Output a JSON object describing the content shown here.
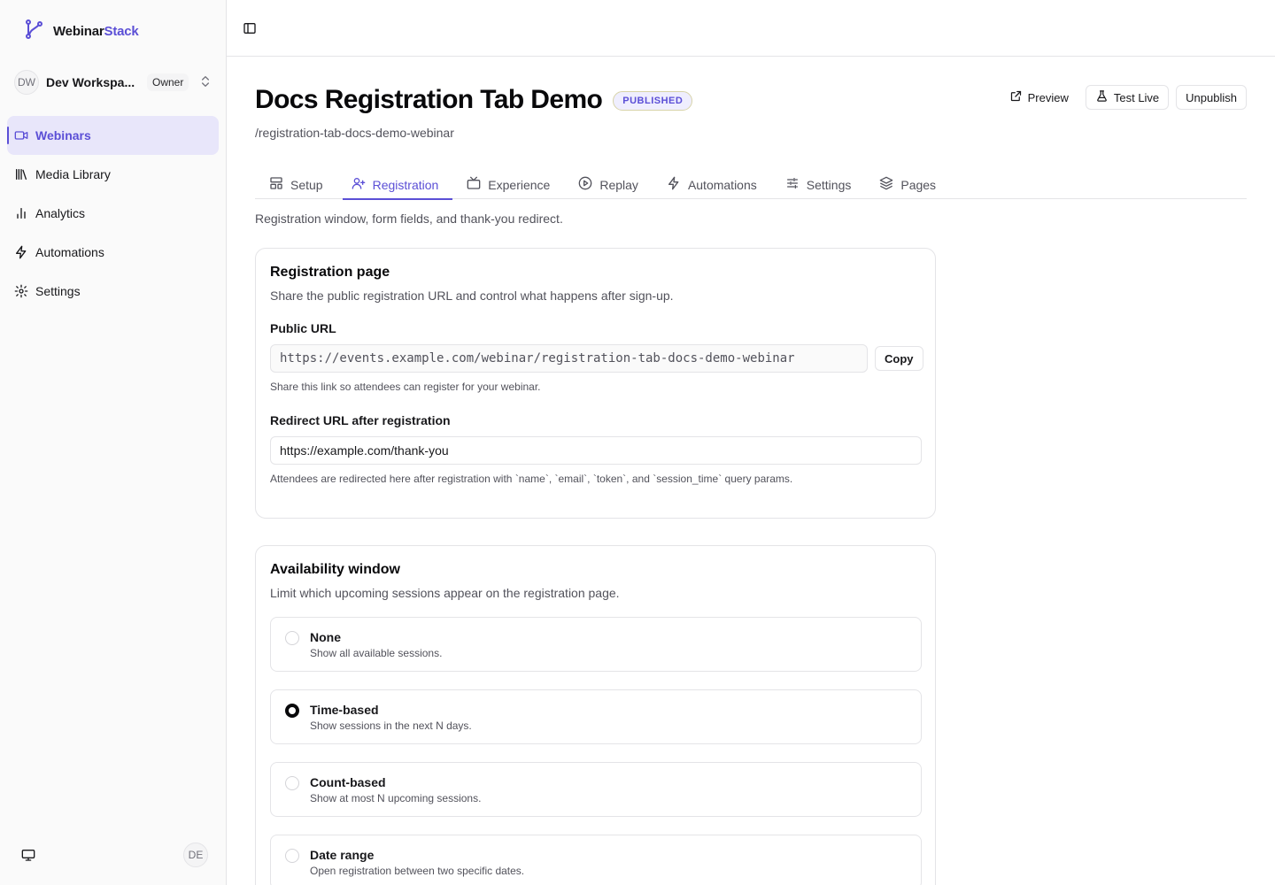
{
  "app": {
    "brand_prefix": "Webinar",
    "brand_accent": "Stack"
  },
  "workspace": {
    "initials": "DW",
    "name": "Dev Workspa...",
    "role": "Owner"
  },
  "nav": [
    {
      "label": "Webinars",
      "icon": "video-icon",
      "active": true
    },
    {
      "label": "Media Library",
      "icon": "library-icon",
      "active": false
    },
    {
      "label": "Analytics",
      "icon": "bar-chart-icon",
      "active": false
    },
    {
      "label": "Automations",
      "icon": "zap-icon",
      "active": false
    },
    {
      "label": "Settings",
      "icon": "gear-icon",
      "active": false
    }
  ],
  "user": {
    "initials": "DE"
  },
  "page": {
    "title": "Docs Registration Tab Demo",
    "status": "PUBLISHED",
    "slug": "/registration-tab-docs-demo-webinar",
    "actions": {
      "preview": "Preview",
      "test_live": "Test Live",
      "unpublish": "Unpublish"
    }
  },
  "tabs": [
    {
      "label": "Setup",
      "icon": "layout-icon"
    },
    {
      "label": "Registration",
      "icon": "user-plus-icon",
      "active": true
    },
    {
      "label": "Experience",
      "icon": "tv-icon"
    },
    {
      "label": "Replay",
      "icon": "play-circle-icon"
    },
    {
      "label": "Automations",
      "icon": "zap-icon"
    },
    {
      "label": "Settings",
      "icon": "sliders-icon"
    },
    {
      "label": "Pages",
      "icon": "layers-icon"
    }
  ],
  "tab_description": "Registration window, form fields, and thank-you redirect.",
  "registration_card": {
    "title": "Registration page",
    "subtitle": "Share the public registration URL and control what happens after sign-up.",
    "public_url_label": "Public URL",
    "public_url_value": "https://events.example.com/webinar/registration-tab-docs-demo-webinar",
    "copy_label": "Copy",
    "public_url_hint": "Share this link so attendees can register for your webinar.",
    "redirect_label": "Redirect URL after registration",
    "redirect_value": "https://example.com/thank-you",
    "redirect_hint": "Attendees are redirected here after registration with `name`, `email`, `token`, and `session_time` query params."
  },
  "availability_card": {
    "title": "Availability window",
    "subtitle": "Limit which upcoming sessions appear on the registration page.",
    "options": [
      {
        "title": "None",
        "desc": "Show all available sessions.",
        "selected": false
      },
      {
        "title": "Time-based",
        "desc": "Show sessions in the next N days.",
        "selected": true
      },
      {
        "title": "Count-based",
        "desc": "Show at most N upcoming sessions.",
        "selected": false
      },
      {
        "title": "Date range",
        "desc": "Open registration between two specific dates.",
        "selected": false
      }
    ]
  },
  "colors": {
    "accent": "#5b4fd6",
    "border": "#e4e4e7",
    "muted_text": "#52525b"
  }
}
